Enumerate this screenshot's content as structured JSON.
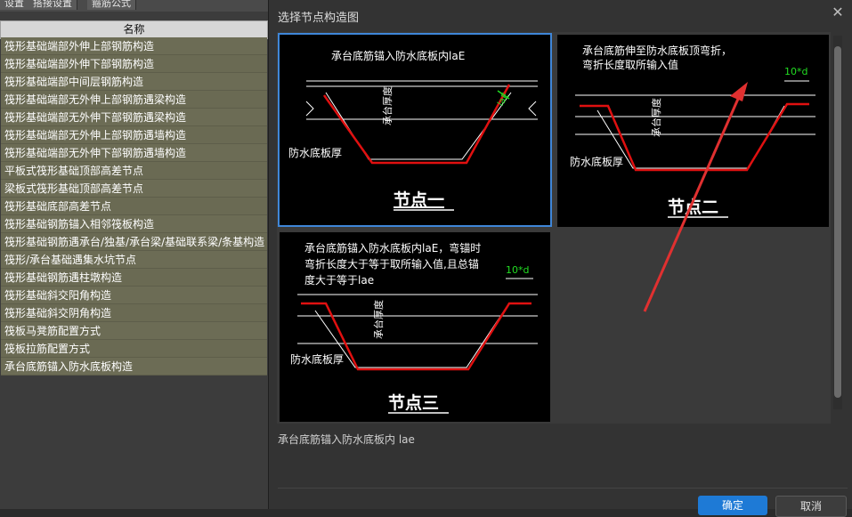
{
  "tabs": [
    "设置",
    "搭接设置",
    "箍筋公式"
  ],
  "list_header": "名称",
  "list_items": [
    "筏形基础端部外伸上部钢筋构造",
    "筏形基础端部外伸下部钢筋构造",
    "筏形基础端部中间层钢筋构造",
    "筏形基础端部无外伸上部钢筋遇梁构造",
    "筏形基础端部无外伸下部钢筋遇梁构造",
    "筏形基础端部无外伸上部钢筋遇墙构造",
    "筏形基础端部无外伸下部钢筋遇墙构造",
    "平板式筏形基础顶部高差节点",
    "梁板式筏形基础顶部高差节点",
    "筏形基础底部高差节点",
    "筏形基础钢筋锚入相邻筏板构造",
    "筏形基础钢筋遇承台/独基/承台梁/基础联系梁/条基构造",
    "筏形/承台基础遇集水坑节点",
    "筏形基础钢筋遇柱墩构造",
    "筏形基础斜交阳角构造",
    "筏形基础斜交阴角构造",
    "筏板马凳筋配置方式",
    "筏板拉筋配置方式",
    "承台底筋锚入防水底板构造"
  ],
  "dialog": {
    "title": "选择节点构造图",
    "caption": "承台底筋锚入防水底板内 lae",
    "ok": "确定",
    "cancel": "取消"
  },
  "nodes": [
    {
      "name": "节点一",
      "desc": [
        "承台底筋锚入防水底板内laE"
      ],
      "label_lae": "laE",
      "label_thick": "承台厚度",
      "label_plate": "防水底板厚",
      "selected": true
    },
    {
      "name": "节点二",
      "desc": [
        "承台底筋伸至防水底板顶弯折，",
        "弯折长度取所输入值"
      ],
      "label_bend": "10*d",
      "label_thick": "承台厚度",
      "label_plate": "防水底板厚",
      "selected": false
    },
    {
      "name": "节点三",
      "desc": [
        "承台底筋锚入防水底板内laE，弯锚时",
        "弯折长度大于等于取所输入值,且总锚",
        "度大于等于lae"
      ],
      "label_bend": "10*d",
      "label_thick": "承台厚度",
      "label_plate": "防水底板厚",
      "selected": false
    }
  ],
  "colors": {
    "accent": "#1e7ad6",
    "rebar": "#e01010",
    "highlight_green": "#22dd22",
    "annotation_arrow": "#e03030"
  }
}
